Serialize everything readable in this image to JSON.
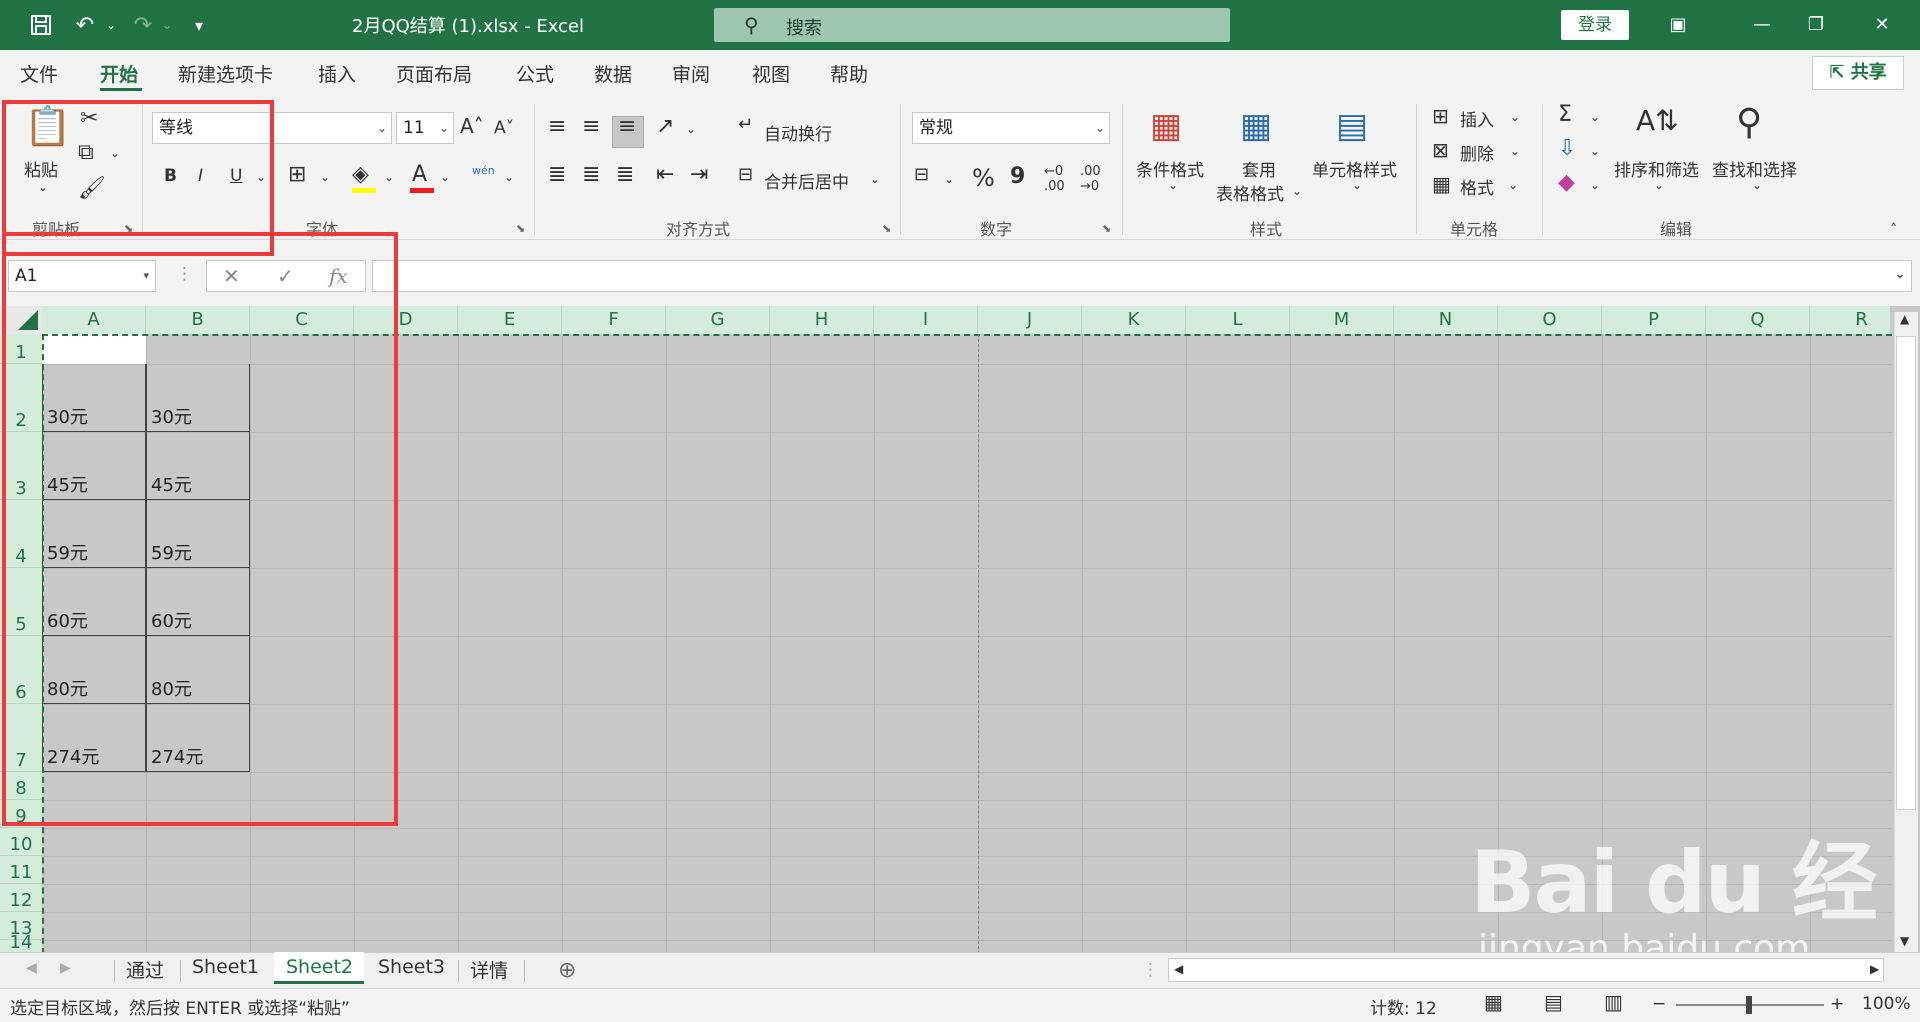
{
  "titlebar": {
    "file_title": "2月QQ结算 (1).xlsx  -  Excel",
    "search_placeholder": "搜索",
    "login_label": "登录"
  },
  "menu": {
    "tabs": [
      "文件",
      "开始",
      "新建选项卡",
      "插入",
      "页面布局",
      "公式",
      "数据",
      "审阅",
      "视图",
      "帮助"
    ],
    "active": "开始",
    "share_label": "共享"
  },
  "ribbon": {
    "clipboard": {
      "paste": "粘贴",
      "group": "剪贴板"
    },
    "font": {
      "name": "等线",
      "size": "11",
      "bold": "B",
      "italic": "I",
      "underline": "U",
      "pinyin": "wén",
      "group": "字体"
    },
    "alignment": {
      "wrap": "自动换行",
      "merge": "合并后居中",
      "group": "对齐方式"
    },
    "number": {
      "format": "常规",
      "percent": "%",
      "comma": "9",
      "group": "数字"
    },
    "styles": {
      "conditional": "条件格式",
      "table_l1": "套用",
      "table_l2": "表格格式",
      "cell_styles": "单元格样式",
      "group": "样式"
    },
    "cells": {
      "insert": "插入",
      "delete": "删除",
      "format": "格式",
      "group": "单元格"
    },
    "editing": {
      "sort": "排序和筛选",
      "find": "查找和选择",
      "group": "编辑"
    }
  },
  "formula_bar": {
    "name_box": "A1",
    "fx": "fx"
  },
  "grid": {
    "columns": [
      "A",
      "B",
      "C",
      "D",
      "E",
      "F",
      "G",
      "H",
      "I",
      "J",
      "K",
      "L",
      "M",
      "N",
      "O",
      "P",
      "Q",
      "R"
    ],
    "rows": [
      "1",
      "2",
      "3",
      "4",
      "5",
      "6",
      "7",
      "8",
      "9",
      "10",
      "11",
      "12",
      "13",
      "14"
    ],
    "cells": [
      {
        "a": "30元",
        "b": "30元"
      },
      {
        "a": "45元",
        "b": "45元"
      },
      {
        "a": "59元",
        "b": "59元"
      },
      {
        "a": "60元",
        "b": "60元"
      },
      {
        "a": "80元",
        "b": "80元"
      },
      {
        "a": "274元",
        "b": "274元"
      }
    ]
  },
  "sheets": {
    "tabs": [
      "通过",
      "Sheet1",
      "Sheet2",
      "Sheet3",
      "详情"
    ],
    "active": "Sheet2"
  },
  "status": {
    "message": "选定目标区域，然后按 ENTER 或选择“粘贴”",
    "count": "计数: 12",
    "zoom": "100%"
  },
  "watermark": {
    "main": "Bai du 经验",
    "sub": "jingyan.baidu.com"
  }
}
